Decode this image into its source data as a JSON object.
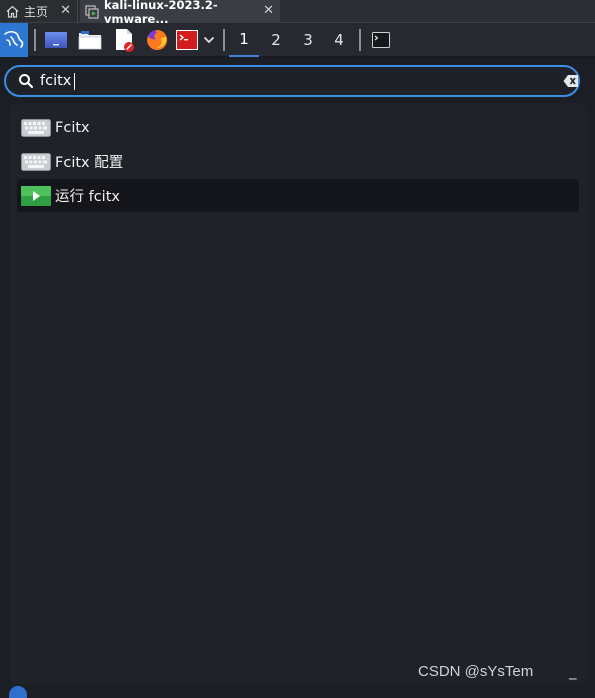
{
  "tabs": [
    {
      "label": "主页",
      "icon": "home-icon"
    },
    {
      "label": "kali-linux-2023.2-vmware...",
      "icon": "vm-icon"
    }
  ],
  "panel": {
    "launchers": [
      "kali-menu-icon",
      "desktop-icon",
      "file-manager-icon",
      "text-editor-icon",
      "firefox-icon",
      "terminal-launcher-icon",
      "chevron-down-icon"
    ],
    "workspaces": [
      "1",
      "2",
      "3",
      "4"
    ],
    "active_workspace": "1",
    "taskbar": [
      "terminal-window-icon"
    ]
  },
  "search": {
    "value": "fcitx",
    "icon": "search-icon",
    "clear_icon": "backspace-clear-icon",
    "accent": "#3a8ee6"
  },
  "results": [
    {
      "label": "Fcitx",
      "icon": "keyboard-icon",
      "selected": false
    },
    {
      "label": "Fcitx 配置",
      "icon": "keyboard-icon",
      "selected": false
    },
    {
      "label": "运行 fcitx",
      "icon": "run-icon",
      "selected": true
    }
  ],
  "watermark": "CSDN @sYsTem",
  "minimize_glyph": "_"
}
